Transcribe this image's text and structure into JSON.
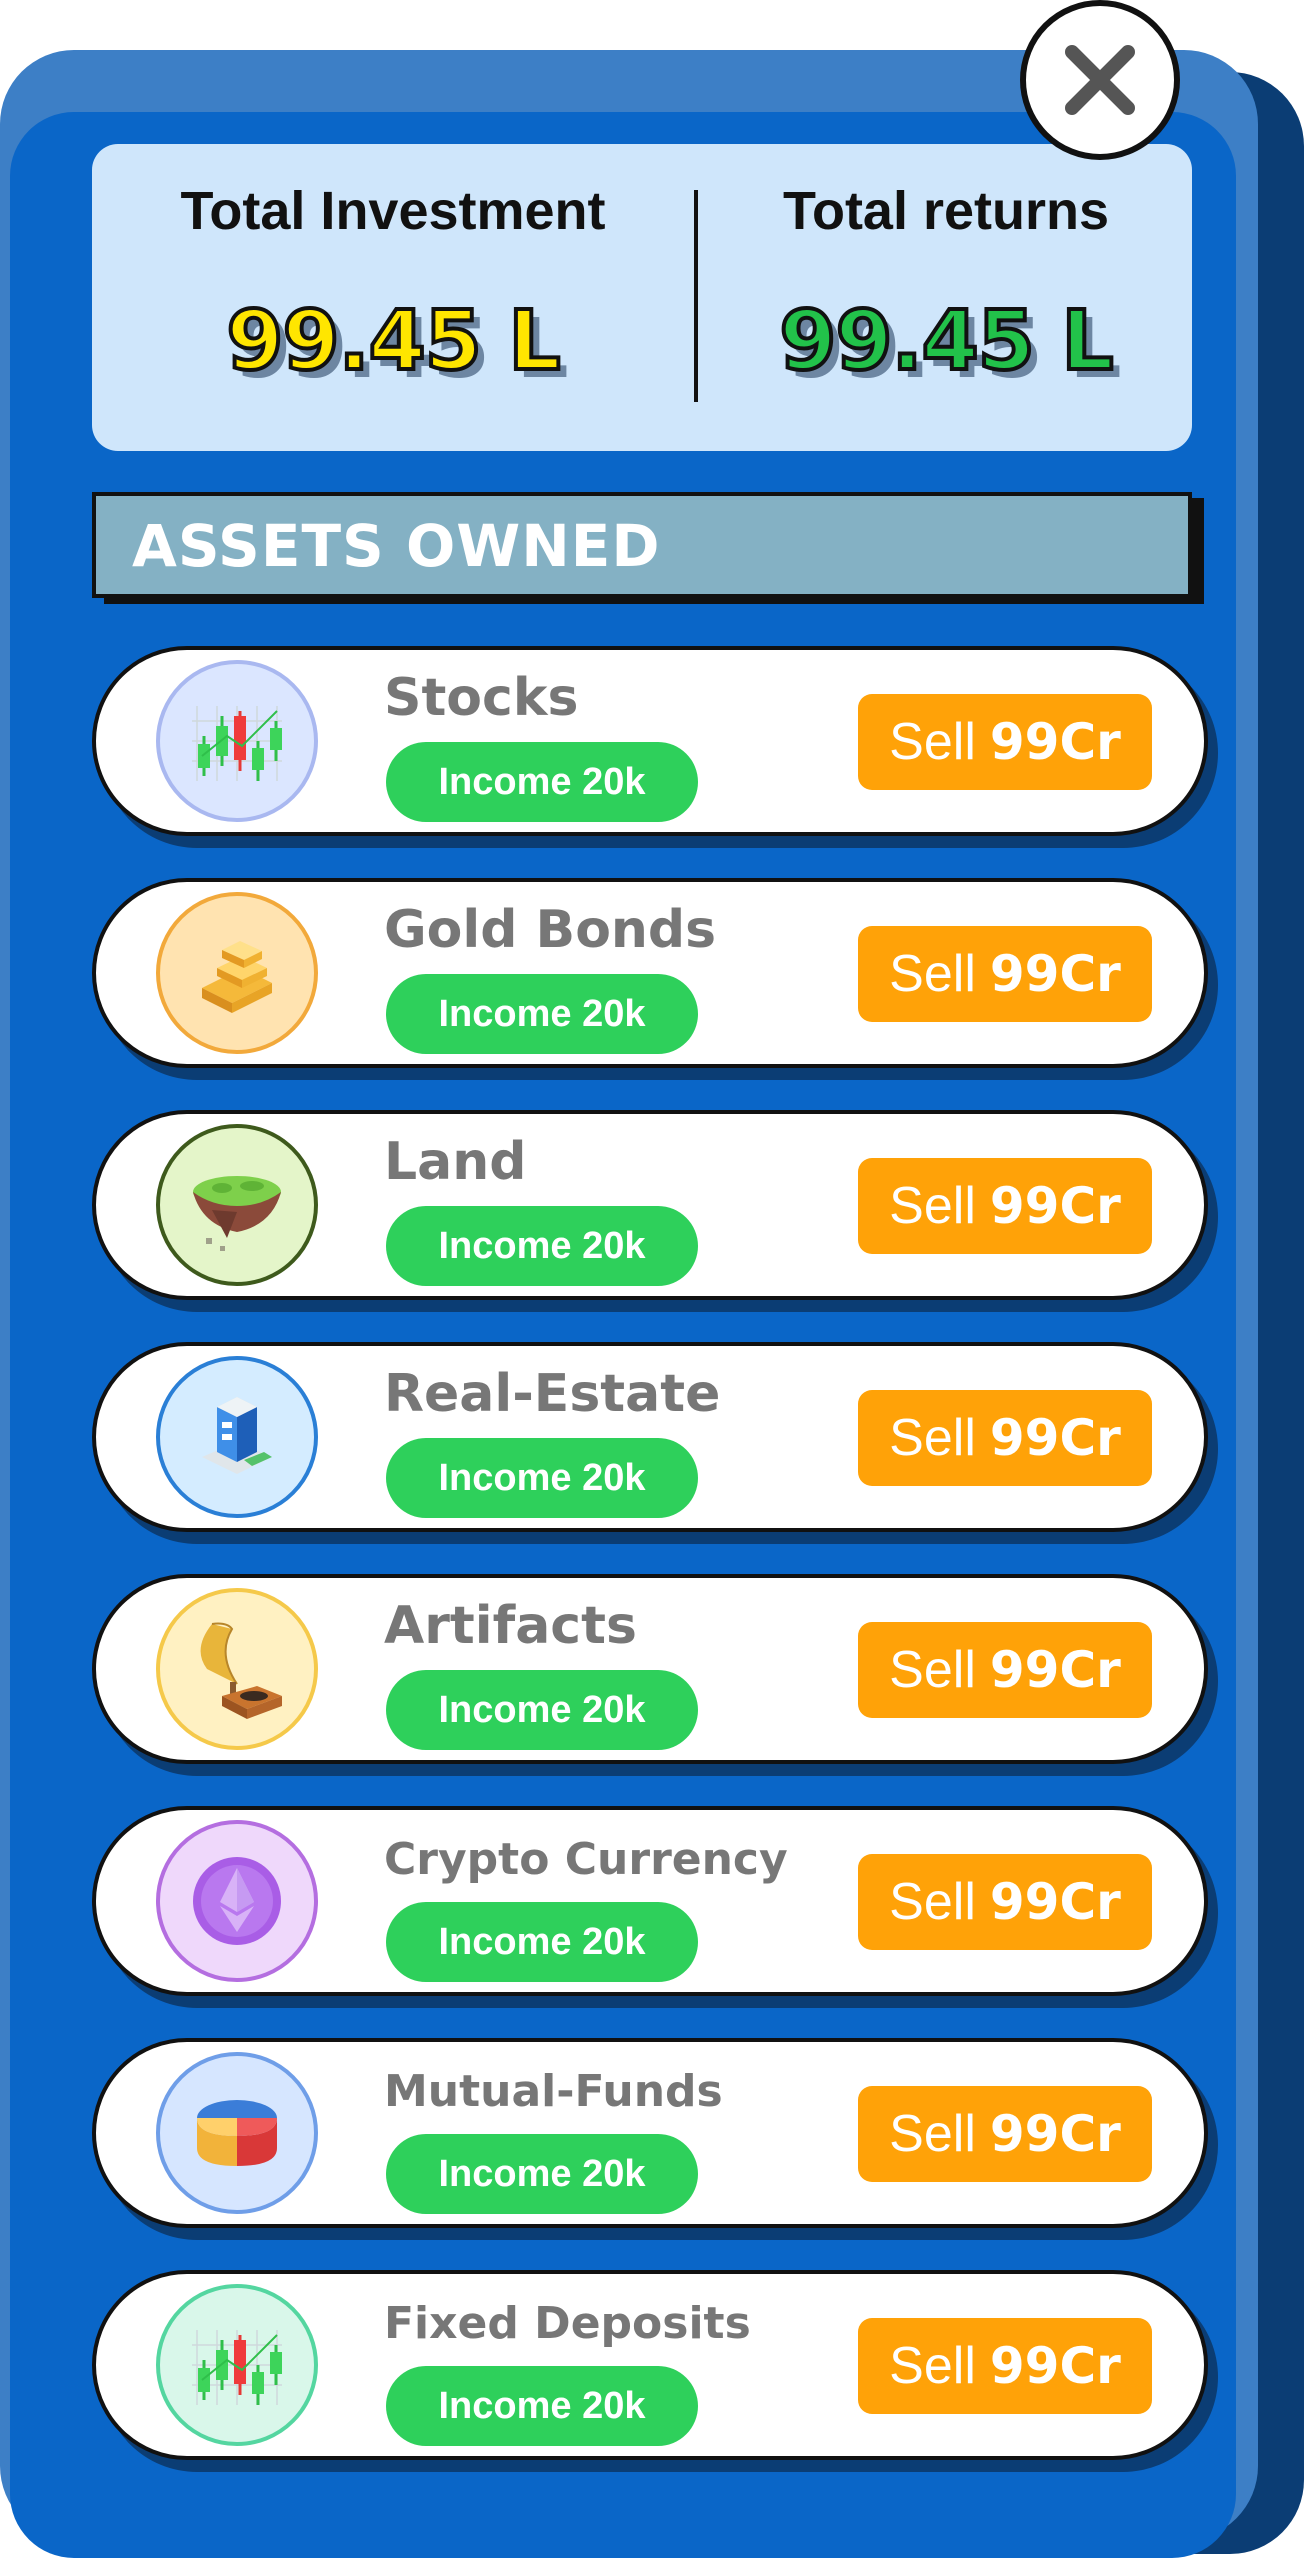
{
  "summary": {
    "investment_label": "Total Investment",
    "investment_value": "99.45 L",
    "returns_label": "Total returns",
    "returns_value": "99.45 L"
  },
  "colors": {
    "investment_value": "#ffe600",
    "returns_value": "#22c24a",
    "income": "#2ed05b",
    "sell": "#ffa208"
  },
  "assets_header": "ASSETS OWNED",
  "assets": [
    {
      "name": "Stocks",
      "income": "Income 20k",
      "sell_label": "Sell",
      "sell_price": "99Cr",
      "icon": "stocks-icon"
    },
    {
      "name": "Gold Bonds",
      "income": "Income 20k",
      "sell_label": "Sell",
      "sell_price": "99Cr",
      "icon": "gold-bars-icon"
    },
    {
      "name": "Land",
      "income": "Income 20k",
      "sell_label": "Sell",
      "sell_price": "99Cr",
      "icon": "land-island-icon"
    },
    {
      "name": "Real-Estate",
      "income": "Income 20k",
      "sell_label": "Sell",
      "sell_price": "99Cr",
      "icon": "building-icon"
    },
    {
      "name": "Artifacts",
      "income": "Income 20k",
      "sell_label": "Sell",
      "sell_price": "99Cr",
      "icon": "gramophone-icon"
    },
    {
      "name": "Crypto Currency",
      "income": "Income 20k",
      "sell_label": "Sell",
      "sell_price": "99Cr",
      "icon": "ethereum-coin-icon"
    },
    {
      "name": "Mutual-Funds",
      "income": "Income 20k",
      "sell_label": "Sell",
      "sell_price": "99Cr",
      "icon": "pie-chart-icon"
    },
    {
      "name": "Fixed Deposits",
      "income": "Income 20k",
      "sell_label": "Sell",
      "sell_price": "99Cr",
      "icon": "candlestick-chart-icon"
    }
  ]
}
